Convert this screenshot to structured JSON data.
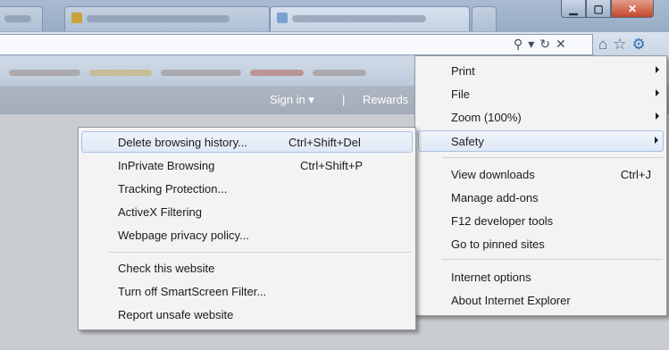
{
  "window": {
    "minimize_icon": "minimize-icon",
    "maximize_icon": "maximize-icon",
    "close_icon": "close-icon"
  },
  "address_bar": {
    "icons": [
      "search-icon",
      "dropdown-icon",
      "refresh-icon",
      "stop-icon"
    ],
    "search_glyph": "⚲",
    "dropdown_glyph": "▾",
    "refresh_glyph": "↻",
    "stop_glyph": "✕"
  },
  "nav_icons": {
    "home_glyph": "⌂",
    "favorites_glyph": "☆",
    "tools_glyph": "⚙"
  },
  "command_bar": {
    "sign_in": "Sign in ▾",
    "divider": "|",
    "rewards": "Rewards"
  },
  "tools_menu": {
    "items": [
      {
        "label": "Print",
        "submenu": true
      },
      {
        "label": "File",
        "submenu": true
      },
      {
        "label": "Zoom (100%)",
        "submenu": true
      },
      {
        "label": "Safety",
        "submenu": true,
        "highlighted": true
      },
      {
        "label": "View downloads",
        "shortcut": "Ctrl+J"
      },
      {
        "label": "Manage add-ons"
      },
      {
        "label": "F12 developer tools"
      },
      {
        "label": "Go to pinned sites"
      },
      {
        "label": "Internet options"
      },
      {
        "label": "About Internet Explorer"
      }
    ]
  },
  "safety_menu": {
    "items": [
      {
        "label": "Delete browsing history...",
        "shortcut": "Ctrl+Shift+Del",
        "highlighted": true
      },
      {
        "label": "InPrivate Browsing",
        "shortcut": "Ctrl+Shift+P"
      },
      {
        "label": "Tracking Protection..."
      },
      {
        "label": "ActiveX Filtering"
      },
      {
        "label": "Webpage privacy policy..."
      },
      {
        "label": "Check this website"
      },
      {
        "label": "Turn off SmartScreen Filter..."
      },
      {
        "label": "Report unsafe website"
      }
    ]
  },
  "colors": {
    "highlight_border": "#a9c1e2",
    "menu_background": "#f3f3f4",
    "close_button": "#c4472b"
  }
}
